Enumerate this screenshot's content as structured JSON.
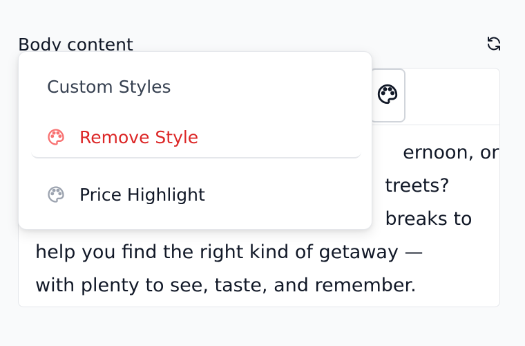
{
  "field": {
    "label": "Body content",
    "reset_icon": "refresh-icon"
  },
  "toolbar": {
    "style_icon": "palette-icon"
  },
  "editor": {
    "lines": [
      "                                                              ernoon, or",
      "                                                           treets?",
      "                                                           breaks to",
      "help you find the right kind of getaway —",
      "with plenty to see, taste, and remember."
    ]
  },
  "popover": {
    "title": "Custom Styles",
    "items": [
      {
        "label": "Remove Style",
        "icon": "palette-icon",
        "color": "#dc2626"
      },
      {
        "label": "Price Highlight",
        "icon": "palette-icon",
        "color": "#9ca3af"
      }
    ]
  },
  "colors": {
    "danger": "#dc2626",
    "text": "#111827",
    "muted": "#374151",
    "border": "#e5e7eb"
  }
}
